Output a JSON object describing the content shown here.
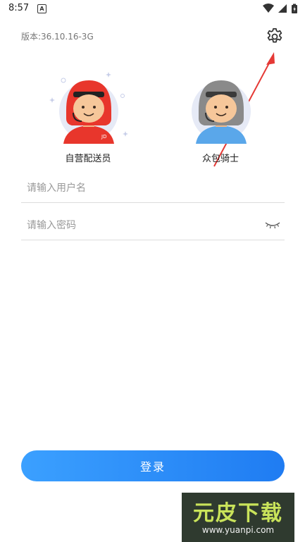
{
  "status_bar": {
    "time": "8:57",
    "notif_letter": "A"
  },
  "header": {
    "version": "版本:36.10.16-3G"
  },
  "roles": [
    {
      "label": "自营配送员"
    },
    {
      "label": "众包骑士"
    }
  ],
  "avatar_badge": "JD",
  "form": {
    "username_placeholder": "请输入用户名",
    "password_placeholder": "请输入密码"
  },
  "login_label": "登录",
  "watermark": {
    "title": "元皮下载",
    "url": "www.yuanpi.com"
  },
  "colors": {
    "accent": "#1f7cf2",
    "red_helmet": "#e8362c",
    "gray_helmet": "#8a8a8a",
    "shirt_blue": "#5aa7ea",
    "arrow": "#e53935"
  }
}
